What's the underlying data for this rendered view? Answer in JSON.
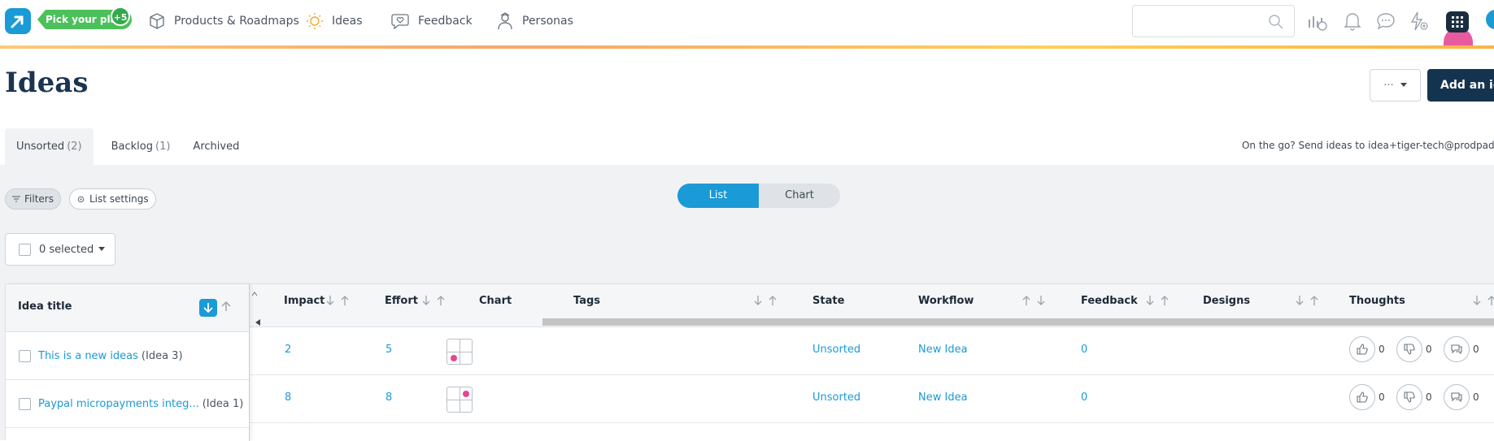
{
  "header": {
    "plan_pill": "Pick your plan",
    "plan_badge": "+5",
    "nav": [
      {
        "label": "Products & Roadmaps",
        "icon": "box-icon"
      },
      {
        "label": "Ideas",
        "icon": "lightbulb-icon"
      },
      {
        "label": "Feedback",
        "icon": "heart-speech-icon"
      },
      {
        "label": "Personas",
        "icon": "persona-icon"
      }
    ],
    "search_placeholder": "",
    "icons": [
      "integrations-icon",
      "bell-icon",
      "chat-icon",
      "lightning-plus-icon",
      "apps-grid-icon"
    ]
  },
  "page": {
    "title": "Ideas",
    "more_label": "···",
    "add_label": "Add an idea"
  },
  "tabs": [
    {
      "label": "Unsorted",
      "count": "(2)",
      "active": true
    },
    {
      "label": "Backlog",
      "count": "(1)",
      "active": false
    },
    {
      "label": "Archived",
      "count": "",
      "active": false
    }
  ],
  "email_note": "On the go? Send ideas to idea+tiger-tech@prodpad.com",
  "toolbar": {
    "filters_label": "Filters",
    "list_settings_label": "List settings",
    "view_list": "List",
    "view_chart": "Chart",
    "selected_label": "0 selected"
  },
  "table": {
    "title_header": "Idea title",
    "columns": {
      "impact": "Impact",
      "effort": "Effort",
      "chart": "Chart",
      "tags": "Tags",
      "state": "State",
      "workflow": "Workflow",
      "feedback": "Feedback",
      "designs": "Designs",
      "thoughts": "Thoughts"
    },
    "rows": [
      {
        "title": "This is a new ideas",
        "ref": "(Idea 3)",
        "impact": "2",
        "effort": "5",
        "chart_quadrant": "bottom-left",
        "state": "Unsorted",
        "workflow": "New Idea",
        "feedback": "0",
        "thumbs_up": "0",
        "thumbs_down": "0",
        "comments": "0"
      },
      {
        "title": "Paypal micropayments integ...",
        "ref": "(Idea 1)",
        "impact": "8",
        "effort": "8",
        "chart_quadrant": "top-right",
        "state": "Unsorted",
        "workflow": "New Idea",
        "feedback": "0",
        "thumbs_up": "0",
        "thumbs_down": "0",
        "comments": "0"
      }
    ]
  },
  "colors": {
    "accent": "#1a9ad6",
    "navy": "#14334f",
    "plan_green": "#4cc05a",
    "chart_dot": "#e64592",
    "panel_bg": "#f0f2f4"
  }
}
